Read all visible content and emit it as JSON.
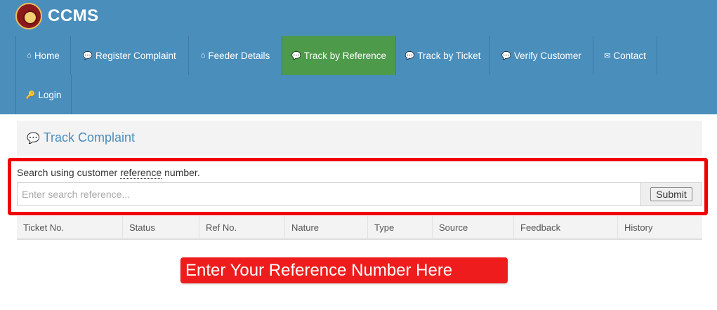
{
  "brand": {
    "name": "CCMS",
    "logo_icon": "emblem-icon"
  },
  "nav": {
    "items": [
      {
        "label": "Home",
        "icon": "home-icon",
        "glyph": "⌂",
        "active": false
      },
      {
        "label": "Register Complaint",
        "icon": "comment-icon",
        "glyph": "💬",
        "active": false
      },
      {
        "label": "Feeder Details",
        "icon": "home-icon",
        "glyph": "⌂",
        "active": false
      },
      {
        "label": "Track by Reference",
        "icon": "comments-icon",
        "glyph": "💬",
        "active": true
      },
      {
        "label": "Track by Ticket",
        "icon": "comments-icon",
        "glyph": "💬",
        "active": false
      },
      {
        "label": "Verify Customer",
        "icon": "comments-icon",
        "glyph": "💬",
        "active": false
      },
      {
        "label": "Contact",
        "icon": "envelope-icon",
        "glyph": "✉",
        "active": false
      },
      {
        "label": "Login",
        "icon": "key-icon",
        "glyph": "🔑",
        "active": false
      }
    ]
  },
  "panel": {
    "title": "Track Complaint",
    "icon": "comment-icon",
    "glyph": "💬"
  },
  "search": {
    "label_prefix": "Search using customer ",
    "label_abbr": "reference",
    "label_suffix": " number.",
    "placeholder": "Enter search reference...",
    "value": "",
    "submit_label": "Submit"
  },
  "table": {
    "columns": [
      "Ticket No.",
      "Status",
      "Ref No.",
      "Nature",
      "Type",
      "Source",
      "Feedback",
      "History"
    ]
  },
  "callout": {
    "text": "Enter Your Reference Number Here"
  },
  "colors": {
    "header_bg": "#4a8ebc",
    "active_nav": "#4d9a4a",
    "annotation_red": "#f00000"
  }
}
